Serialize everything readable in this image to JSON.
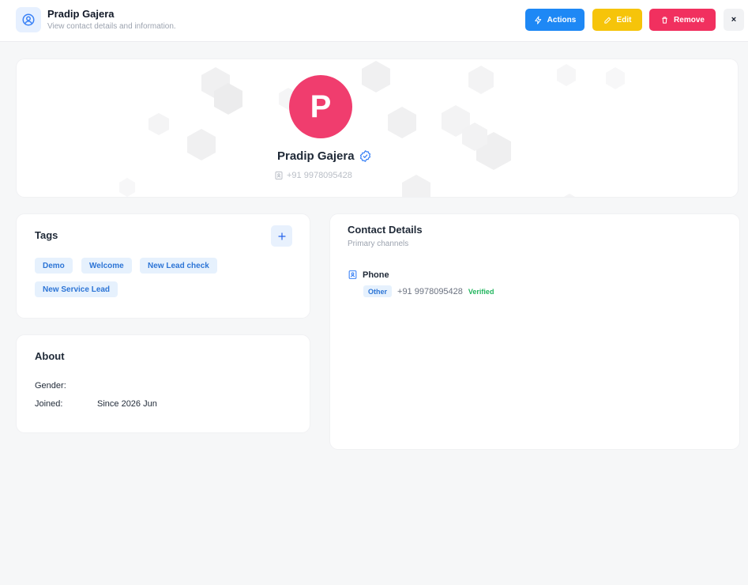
{
  "header": {
    "title": "Pradip Gajera",
    "subtitle": "View contact details and information.",
    "buttons": {
      "actions": "Actions",
      "edit": "Edit",
      "remove": "Remove",
      "close": "×"
    }
  },
  "profile": {
    "avatar_initial": "P",
    "name": "Pradip Gajera",
    "phone": "+91 9978095428",
    "avatar_color": "#f03d6e"
  },
  "tags": {
    "title": "Tags",
    "items": [
      "Demo",
      "Welcome",
      "New Lead check",
      "New Service Lead"
    ]
  },
  "about": {
    "title": "About",
    "gender_label": "Gender:",
    "gender_value": "",
    "joined_label": "Joined:",
    "joined_value": "Since 2026 Jun"
  },
  "contact": {
    "title": "Contact Details",
    "subtitle": "Primary channels",
    "phone_heading": "Phone",
    "phone_type": "Other",
    "phone_number": "+91 9978095428",
    "verified_label": "Verified"
  },
  "colors": {
    "actions": "#1e88f5",
    "edit": "#f6c40a",
    "remove": "#f1305f",
    "verified": "#22b55e",
    "tag_text": "#2d75d6"
  }
}
